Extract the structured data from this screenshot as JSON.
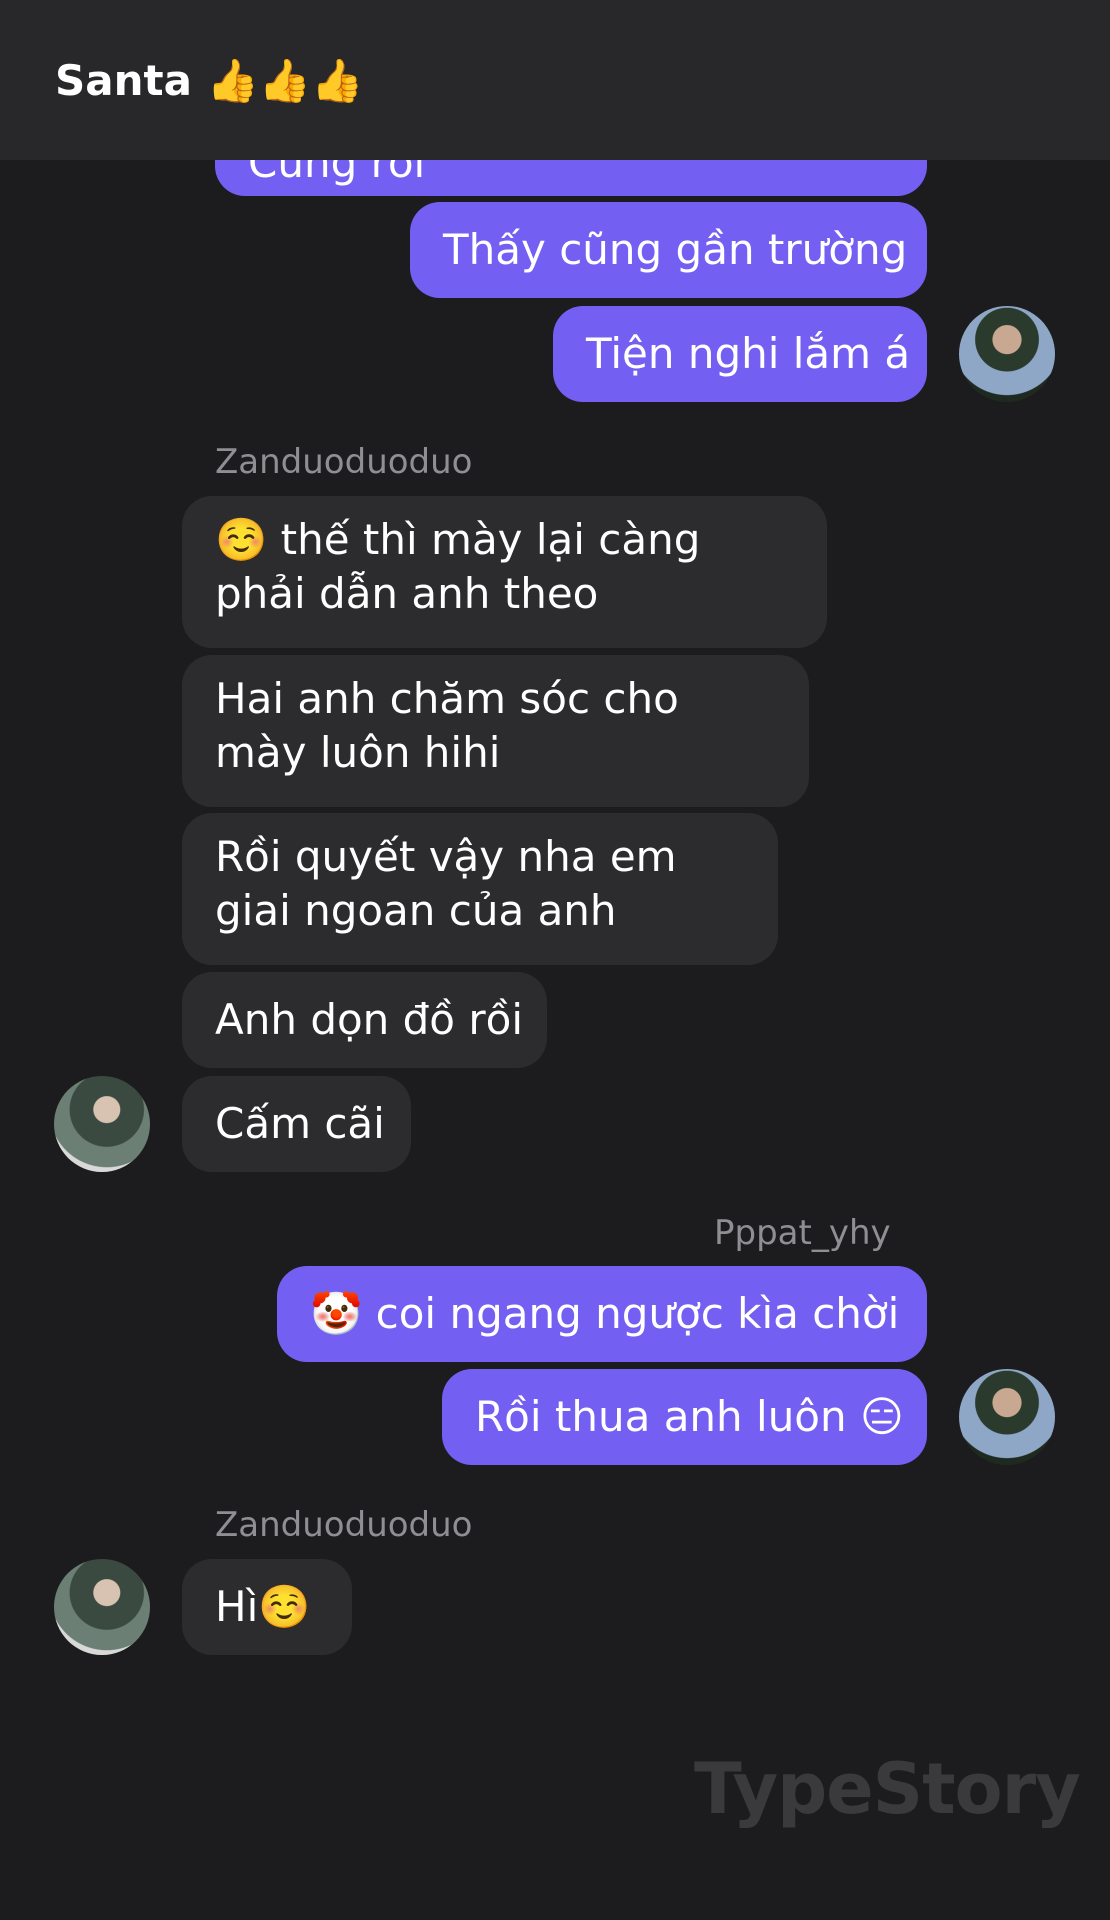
{
  "header": {
    "title": "Santa 👍👍👍"
  },
  "messages": {
    "m0": "Cũng rồi",
    "m1": "Thấy cũng gần trường",
    "m2": "Tiện nghi lắm á",
    "sender_z1": "Zanduoduoduo",
    "m3": "☺️ thế thì mày lại càng phải dẫn anh theo",
    "m4": "Hai anh chăm sóc cho mày luôn hihi",
    "m5": "Rồi quyết vậy nha em giai ngoan của anh",
    "m6": "Anh dọn đồ rồi",
    "m7": "Cấm cãi",
    "sender_p": "Pppat_yhy",
    "m8": "🤡 coi ngang ngược kìa chời",
    "m9": "Rồi thua anh luôn 😑",
    "sender_z2": "Zanduoduoduo",
    "m10": "Hì☺️"
  },
  "watermark": "TypeStory",
  "colors": {
    "outgoing": "#7360f2",
    "incoming": "#2c2c2e",
    "background": "#1c1c1e",
    "header": "#28282a"
  }
}
